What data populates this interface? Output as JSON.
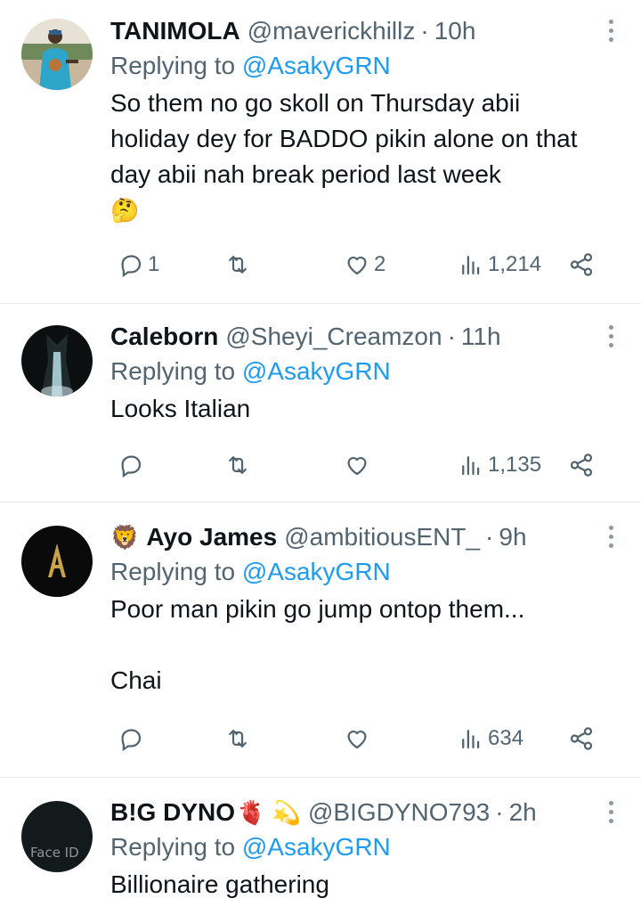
{
  "tweets": [
    {
      "name": "TANIMOLA",
      "handle": "@maverickhillz",
      "time": "10h",
      "replying_prefix": "Replying to ",
      "replying_to": "@AsakyGRN",
      "text": "So them no go skoll on Thursday abii holiday dey for BADDO pikin alone on that day abii nah break period last week",
      "text_emoji": "🤔",
      "replies": "1",
      "likes": "2",
      "views": "1,214"
    },
    {
      "name": "Caleborn",
      "handle": "@Sheyi_Creamzon",
      "time": "11h",
      "replying_prefix": "Replying to ",
      "replying_to": "@AsakyGRN",
      "text": "Looks Italian",
      "views": "1,135"
    },
    {
      "name_prefix_emoji": "🦁",
      "name": "Ayo James",
      "handle": "@ambitiousENT_",
      "time": "9h",
      "replying_prefix": "Replying to ",
      "replying_to": "@AsakyGRN",
      "text": "Poor man pikin go jump ontop them...\n\nChai",
      "views": "634"
    },
    {
      "name": "B!G DYNO",
      "name_suffix_emoji": "🫀 💫",
      "handle": "@BIGDYNO793",
      "time": "2h",
      "replying_prefix": "Replying to ",
      "replying_to": "@AsakyGRN",
      "text": "Billionaire gathering",
      "avatar_text": "Face ID"
    }
  ],
  "separator": "·",
  "colors": {
    "link": "#1d9bf0",
    "muted": "#536471",
    "text": "#0f1419",
    "divider": "#e6e9ec"
  },
  "icons": [
    "reply-icon",
    "retweet-icon",
    "like-icon",
    "views-icon",
    "share-icon",
    "more-icon"
  ]
}
